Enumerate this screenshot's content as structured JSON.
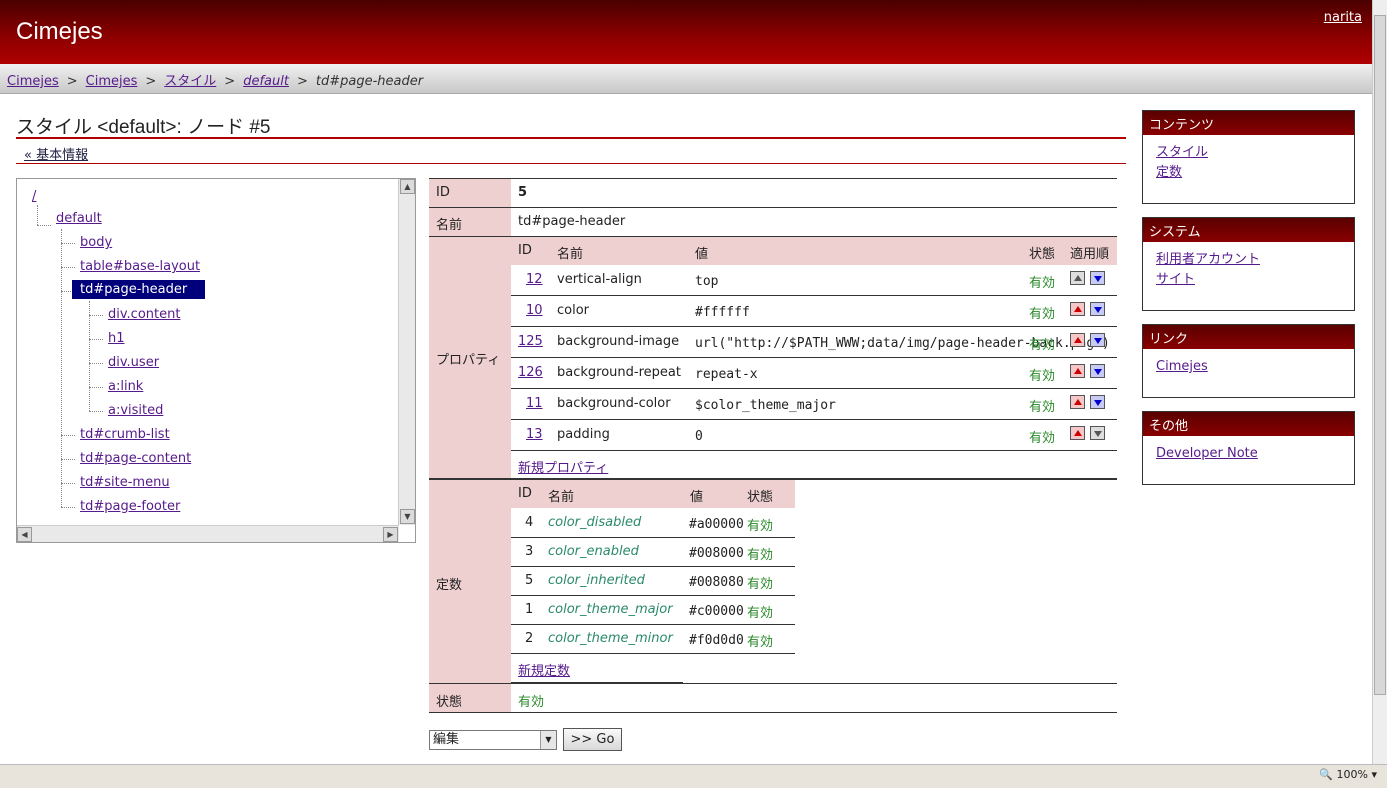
{
  "header": {
    "brand": "Cimejes",
    "user": "narita"
  },
  "breadcrumb": {
    "items": [
      "Cimejes",
      "Cimejes",
      "スタイル",
      "default"
    ],
    "current": "td#page-header",
    "separator": ">"
  },
  "page": {
    "title": "スタイル <default>: ノード #5",
    "back_link": "« 基本情報"
  },
  "tree": {
    "nodes": [
      "/",
      "default",
      "body",
      "table#base-layout",
      "td#page-header",
      "div.content",
      "h1",
      "div.user",
      "a:link",
      "a:visited",
      "td#crumb-list",
      "td#page-content",
      "td#site-menu",
      "td#page-footer"
    ],
    "selected": "td#page-header"
  },
  "detail": {
    "id_label": "ID",
    "id_value": "5",
    "name_label": "名前",
    "name_value": "td#page-header",
    "props_label": "プロパティ",
    "props_headers": {
      "id": "ID",
      "name": "名前",
      "value": "値",
      "status": "状態",
      "order": "適用順"
    },
    "props": [
      {
        "id": "12",
        "name": "vertical-align",
        "value": "top",
        "status": "有効"
      },
      {
        "id": "10",
        "name": "color",
        "value": "#ffffff",
        "status": "有効"
      },
      {
        "id": "125",
        "name": "background-image",
        "value": "url(\"http://$PATH_WWW;data/img/page-header-back.png\")",
        "status": "有効"
      },
      {
        "id": "126",
        "name": "background-repeat",
        "value": "repeat-x",
        "status": "有効"
      },
      {
        "id": "11",
        "name": "background-color",
        "value": "$color_theme_major",
        "status": "有効"
      },
      {
        "id": "13",
        "name": "padding",
        "value": "0",
        "status": "有効"
      }
    ],
    "new_prop": "新規プロパティ",
    "const_label": "定数",
    "const_headers": {
      "id": "ID",
      "name": "名前",
      "value": "値",
      "status": "状態"
    },
    "consts": [
      {
        "id": "4",
        "name": "color_disabled",
        "value": "#a00000",
        "status": "有効"
      },
      {
        "id": "3",
        "name": "color_enabled",
        "value": "#008000",
        "status": "有効"
      },
      {
        "id": "5",
        "name": "color_inherited",
        "value": "#008080",
        "status": "有効"
      },
      {
        "id": "1",
        "name": "color_theme_major",
        "value": "#c00000",
        "status": "有効"
      },
      {
        "id": "2",
        "name": "color_theme_minor",
        "value": "#f0d0d0",
        "status": "有効"
      }
    ],
    "new_const": "新規定数",
    "state_label": "状態",
    "state_value": "有効"
  },
  "actions": {
    "select_value": "編集",
    "go_label": ">> Go"
  },
  "sidebar": {
    "contents": {
      "title": "コンテンツ",
      "links": [
        "スタイル",
        "定数"
      ]
    },
    "system": {
      "title": "システム",
      "links": [
        "利用者アカウント",
        "サイト"
      ]
    },
    "links": {
      "title": "リンク",
      "links": [
        "Cimejes"
      ]
    },
    "other": {
      "title": "その他",
      "links": [
        "Developer Note"
      ]
    }
  },
  "status": {
    "zoom": "100%"
  },
  "colors": {
    "header": "#8a0000",
    "label_bg": "#efd0d0",
    "selected": "#00007a",
    "ok": "#2a8a2a"
  }
}
